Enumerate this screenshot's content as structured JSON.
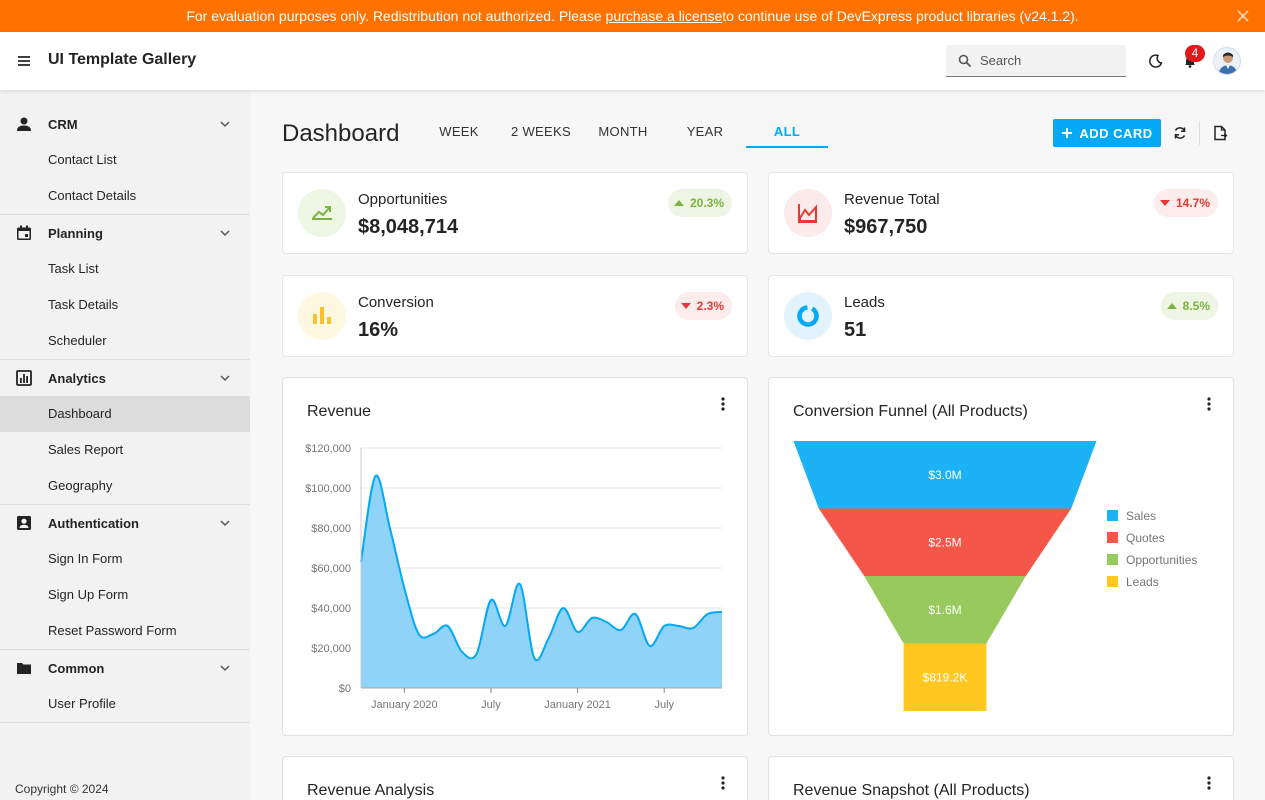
{
  "banner": {
    "prefix": "For evaluation purposes only. Redistribution not authorized. Please ",
    "link": "purchase a license",
    "suffix": " to continue use of DevExpress product libraries (v24.1.2).",
    "color": "#ff7200"
  },
  "header": {
    "title": "UI Template Gallery",
    "search_placeholder": "Search",
    "notification_count": "4"
  },
  "sidebar": {
    "groups": [
      {
        "label": "CRM",
        "icon": "person-icon",
        "items": [
          "Contact List",
          "Contact Details"
        ]
      },
      {
        "label": "Planning",
        "icon": "calendar-icon",
        "items": [
          "Task List",
          "Task Details",
          "Scheduler"
        ]
      },
      {
        "label": "Analytics",
        "icon": "chart-box-icon",
        "items": [
          "Dashboard",
          "Sales Report",
          "Geography"
        ]
      },
      {
        "label": "Authentication",
        "icon": "account-box-icon",
        "items": [
          "Sign In Form",
          "Sign Up Form",
          "Reset Password Form"
        ]
      },
      {
        "label": "Common",
        "icon": "folder-icon",
        "items": [
          "User Profile"
        ]
      }
    ],
    "active_item": "Dashboard",
    "copyright": "Copyright © 2024"
  },
  "main": {
    "title": "Dashboard",
    "tabs": [
      "WEEK",
      "2 WEEKS",
      "MONTH",
      "YEAR",
      "ALL"
    ],
    "active_tab": "ALL",
    "add_card_label": "ADD CARD",
    "accent": "#03a9f4"
  },
  "kpis": [
    {
      "label": "Opportunities",
      "value": "$8,048,714",
      "change": "20.3%",
      "direction": "up",
      "icon": "trending-up-icon",
      "color": "#7cb342"
    },
    {
      "label": "Revenue Total",
      "value": "$967,750",
      "change": "14.7%",
      "direction": "down",
      "icon": "area-chart-icon",
      "color": "#e53935"
    },
    {
      "label": "Conversion",
      "value": "16%",
      "change": "2.3%",
      "direction": "down",
      "icon": "bar-chart-icon",
      "color": "#fbc02d"
    },
    {
      "label": "Leads",
      "value": "51",
      "change": "8.5%",
      "direction": "up",
      "icon": "donut-icon",
      "color": "#03a9f4"
    }
  ],
  "cards": {
    "revenue_title": "Revenue",
    "funnel_title": "Conversion Funnel (All Products)",
    "analysis_title": "Revenue Analysis",
    "snapshot_title": "Revenue Snapshot (All Products)"
  },
  "chart_data": [
    {
      "type": "area",
      "title": "Revenue",
      "x": [
        "2019-11",
        "2019-11",
        "2019-12",
        "2020-01",
        "2020-02",
        "2020-03",
        "2020-04",
        "2020-05",
        "2020-06",
        "2020-07",
        "2020-08",
        "2020-09",
        "2020-10",
        "2020-11",
        "2020-12",
        "2021-01",
        "2021-02",
        "2021-03",
        "2021-04",
        "2021-05",
        "2021-06",
        "2021-07",
        "2021-08",
        "2021-09",
        "2021-10",
        "2021-11"
      ],
      "y": [
        63000,
        106000,
        80000,
        50000,
        27000,
        27000,
        31000,
        18000,
        17000,
        44000,
        31000,
        52000,
        15000,
        25000,
        40000,
        28000,
        35000,
        33000,
        29000,
        37000,
        21000,
        31000,
        31000,
        30000,
        37000,
        38000
      ],
      "xticks": [
        "January 2020",
        "July",
        "January 2021",
        "July"
      ],
      "yticks": [
        "$0",
        "$20,000",
        "$40,000",
        "$60,000",
        "$80,000",
        "$100,000",
        "$120,000"
      ],
      "ylim": [
        0,
        120000
      ],
      "color": "#03a9f4"
    },
    {
      "type": "funnel",
      "title": "Conversion Funnel (All Products)",
      "categories": [
        "Sales",
        "Quotes",
        "Opportunities",
        "Leads"
      ],
      "values": [
        3000000,
        2500000,
        1600000,
        819200
      ],
      "labels": [
        "$3.0M",
        "$2.5M",
        "$1.6M",
        "$819.2K"
      ],
      "colors": [
        "#1db2f5",
        "#f5564a",
        "#97c95c",
        "#ffc720"
      ],
      "legend": "right"
    }
  ]
}
